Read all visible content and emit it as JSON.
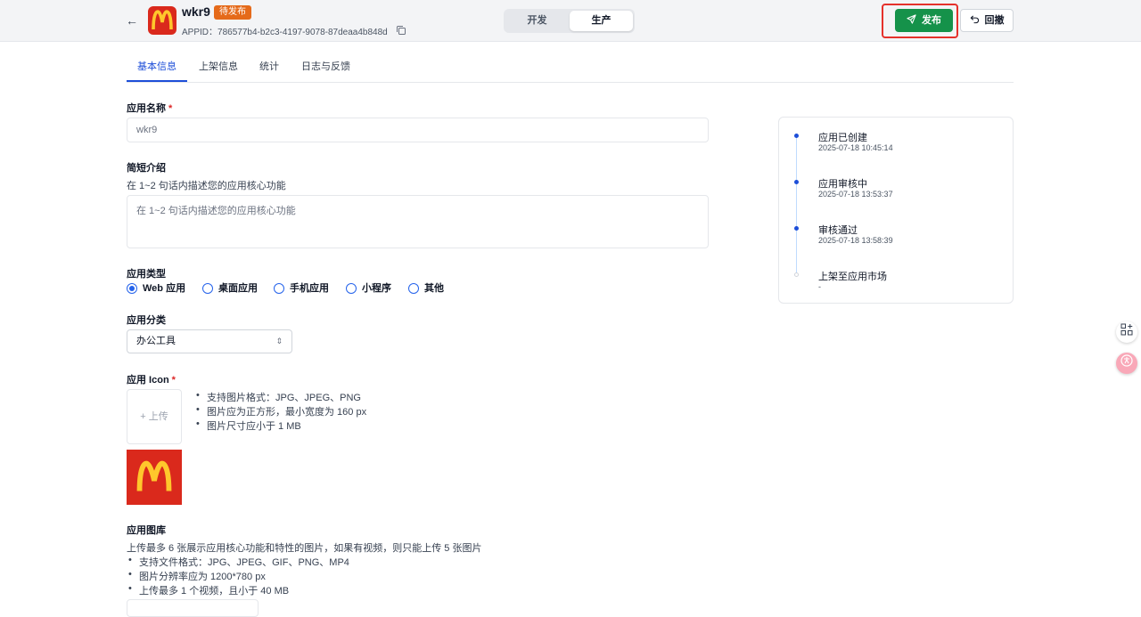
{
  "header": {
    "back_label": "←",
    "app_name": "wkr9",
    "status_badge": "待发布",
    "appid": "APPID：786577b4-b2c3-4197-9078-87deaa4b848d",
    "env_tabs": [
      "开发",
      "生产"
    ],
    "active_env": "生产",
    "publish_label": "发布",
    "rollback_label": "回撤"
  },
  "tabs": [
    "基本信息",
    "上架信息",
    "统计",
    "日志与反馈"
  ],
  "form": {
    "name_label": "应用名称",
    "required_mark": "*",
    "name_value": "wkr9",
    "intro_label": "简短介绍",
    "intro_help": "在 1~2 句话内描述您的应用核心功能",
    "intro_placeholder": "在 1~2 句话内描述您的应用核心功能",
    "type_label": "应用类型",
    "types": [
      "Web 应用",
      "桌面应用",
      "手机应用",
      "小程序",
      "其他"
    ],
    "selected_type": "Web 应用",
    "category_label": "应用分类",
    "category_value": "办公工具",
    "icon_label": "应用 Icon",
    "upload_label": "+ 上传",
    "icon_rules": [
      "支持图片格式：JPG、JPEG、PNG",
      "图片应为正方形，最小宽度为 160 px",
      "图片尺寸应小于 1 MB"
    ],
    "gallery_label": "应用图库",
    "gallery_help": "上传最多 6 张展示应用核心功能和特性的图片，如果有视频，则只能上传 5 张图片",
    "gallery_rules": [
      "支持文件格式：JPG、JPEG、GIF、PNG、MP4",
      "图片分辨率应为 1200*780 px",
      "上传最多 1 个视频，且小于 40 MB"
    ]
  },
  "timeline": [
    {
      "title": "应用已创建",
      "time": "2025-07-18 10:45:14",
      "done": true
    },
    {
      "title": "应用审核中",
      "time": "2025-07-18 13:53:37",
      "done": true
    },
    {
      "title": "审核通过",
      "time": "2025-07-18 13:58:39",
      "done": true
    },
    {
      "title": "上架至应用市场",
      "time": "-",
      "done": false
    }
  ],
  "colors": {
    "brand_red": "#da291c",
    "arches": "#ffc72c",
    "publish_green": "#15924a",
    "highlight": "#e5312b",
    "accent_blue": "#1d4ed8"
  },
  "icons": [
    "back-arrow-icon",
    "copy-icon",
    "send-icon",
    "undo-icon",
    "chevron-updown-icon",
    "grid-plus-icon",
    "translate-icon"
  ]
}
